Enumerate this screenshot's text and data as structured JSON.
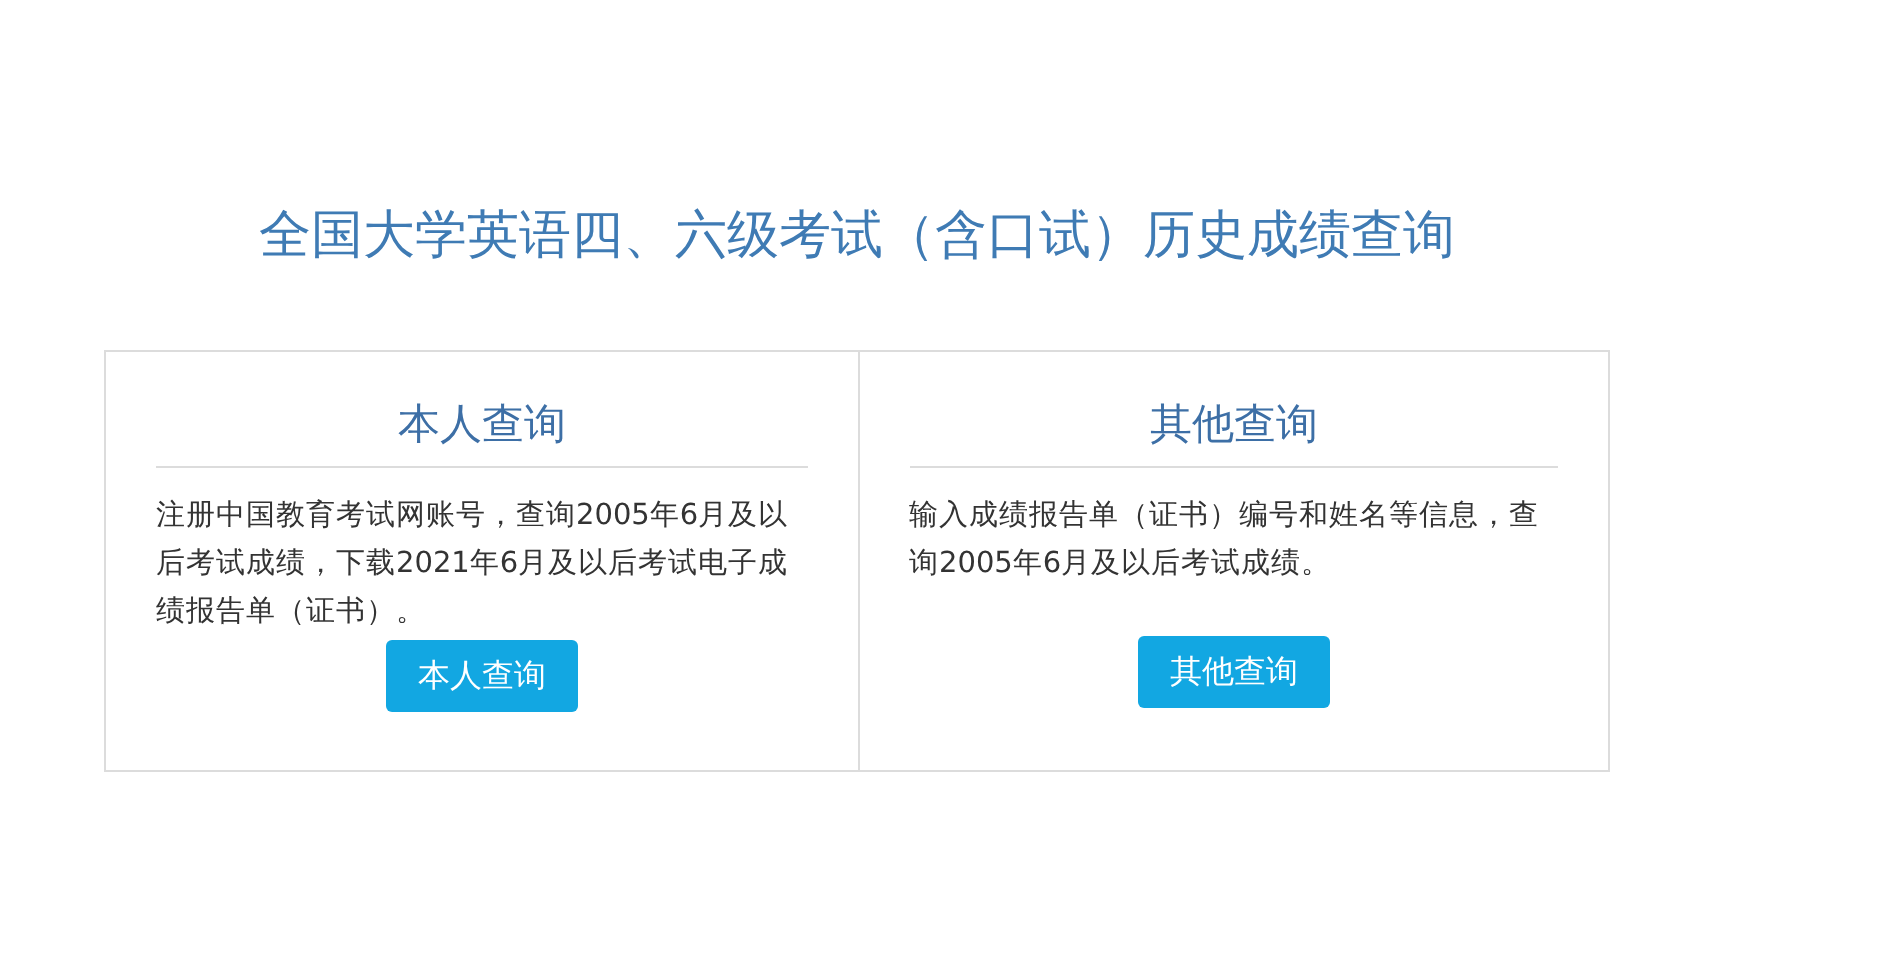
{
  "title": "全国大学英语四、六级考试（含口试）历史成绩查询",
  "panels": [
    {
      "heading": "本人查询",
      "description": "注册中国教育考试网账号，查询2005年6月及以后考试成绩，下载2021年6月及以后考试电子成绩报告单（证书）。",
      "button": "本人查询"
    },
    {
      "heading": "其他查询",
      "description": "输入成绩报告单（证书）编号和姓名等信息，查询2005年6月及以后考试成绩。",
      "button": "其他查询"
    }
  ]
}
